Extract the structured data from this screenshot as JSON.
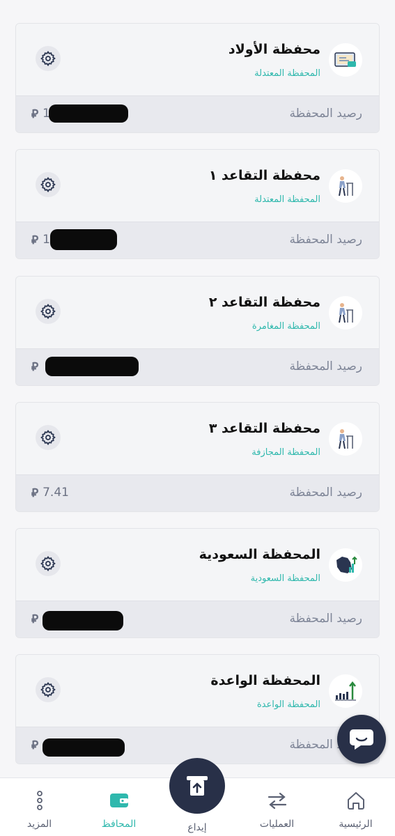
{
  "wallets": [
    {
      "name": "محفظة الأولاد",
      "type": "المحفظة المعتدلة",
      "balance_label": "رصيد المحفظة",
      "balance": "16",
      "currency": "⃁",
      "icon": "certificate-icon"
    },
    {
      "name": "محفظة التقاعد ١",
      "type": "المحفظة المعتدلة",
      "balance_label": "رصيد المحفظة",
      "balance": "1",
      "currency": "⃁",
      "icon": "elderly-walker-icon"
    },
    {
      "name": "محفظة التقاعد ٢",
      "type": "المحفظة المغامرة",
      "balance_label": "رصيد المحفظة",
      "balance": "",
      "currency": "⃁",
      "icon": "elderly-walker-icon"
    },
    {
      "name": "محفظة التقاعد ٣",
      "type": "المحفظة المجازفة",
      "balance_label": "رصيد المحفظة",
      "balance": "7.41",
      "currency": "⃁",
      "icon": "elderly-walker-icon"
    },
    {
      "name": "المحفظة السعودية",
      "type": "المحفظة السعودية",
      "balance_label": "رصيد المحفظة",
      "balance": "",
      "currency": "⃁",
      "icon": "saudi-map-icon"
    },
    {
      "name": "المحفظة الواعدة",
      "type": "المحفظة الواعدة",
      "balance_label": "رصيد المحفظة",
      "balance": "",
      "currency": "⃁",
      "icon": "growth-bars-icon"
    }
  ],
  "tabs": {
    "home": "الرئيسية",
    "operations": "العمليات",
    "deposit": "إيداع",
    "wallets": "المحافظ",
    "more": "المزيد"
  },
  "colors": {
    "accent": "#2fb8ad",
    "navy": "#283048"
  }
}
